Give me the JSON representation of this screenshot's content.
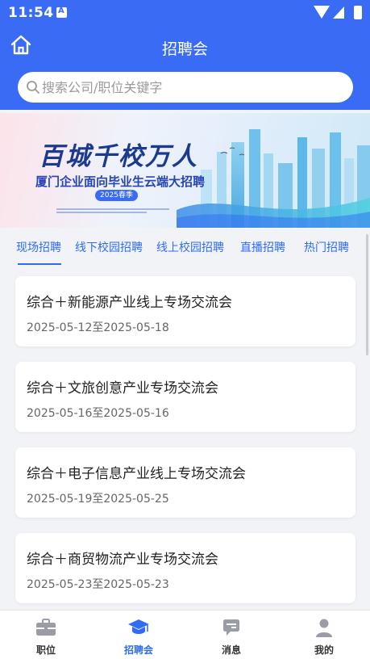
{
  "status_bar": {
    "time": "11:54"
  },
  "header": {
    "title": "招聘会"
  },
  "search": {
    "placeholder": "搜索公司/职位关键字"
  },
  "banner": {
    "title": "百城千校万人",
    "subtitle": "厦门企业面向毕业生云端大招聘",
    "season": "2025春季"
  },
  "tabs": [
    {
      "label": "现场招聘",
      "active": true
    },
    {
      "label": "线下校园招聘",
      "active": false
    },
    {
      "label": "线上校园招聘",
      "active": false
    },
    {
      "label": "直播招聘",
      "active": false
    },
    {
      "label": "热门招聘",
      "active": false
    }
  ],
  "fairs": [
    {
      "title": "综合＋新能源产业线上专场交流会",
      "date": "2025-05-12至2025-05-18"
    },
    {
      "title": "综合＋文旅创意产业专场交流会",
      "date": "2025-05-16至2025-05-16"
    },
    {
      "title": "综合＋电子信息产业线上专场交流会",
      "date": "2025-05-19至2025-05-25"
    },
    {
      "title": "综合＋商贸物流产业专场交流会",
      "date": "2025-05-23至2025-05-23"
    }
  ],
  "bottom_nav": [
    {
      "label": "职位",
      "icon": "briefcase-icon",
      "active": false
    },
    {
      "label": "招聘会",
      "icon": "graduation-cap-icon",
      "active": true
    },
    {
      "label": "消息",
      "icon": "message-icon",
      "active": false
    },
    {
      "label": "我的",
      "icon": "person-icon",
      "active": false
    }
  ],
  "colors": {
    "primary": "#3a6bf5",
    "tab_active": "#2f6cf2",
    "background": "#f2f3f7"
  }
}
